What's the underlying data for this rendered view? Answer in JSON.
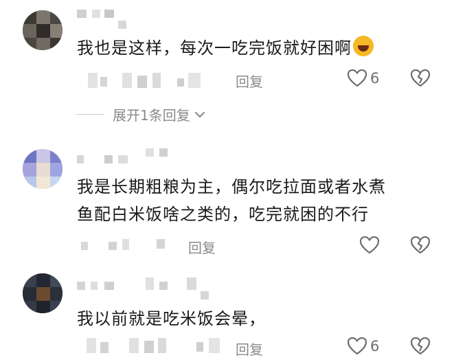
{
  "comments": [
    {
      "text_lines": [
        "我也是这样，每次一吃完饭就好困啊"
      ],
      "emoji": "laughing-crying-emoji",
      "reply_label": "回复",
      "likes": "6",
      "expand_label": "展开1条回复"
    },
    {
      "text_lines": [
        "我是长期粗粮为主，偶尔吃拉面或者水煮",
        "鱼配白米饭啥之类的，吃完就困的不行"
      ],
      "reply_label": "回复",
      "likes": ""
    },
    {
      "text_lines": [
        "我以前就是吃米饭会晕，"
      ],
      "reply_label": "回复",
      "likes": "6"
    }
  ],
  "icons": {
    "like": "heart-outline-icon",
    "dislike": "broken-heart-icon",
    "expand": "chevron-down-icon"
  },
  "colors": {
    "text": "#1a1a1a",
    "secondary": "#8a8a8a",
    "icon": "#6e6e6e"
  }
}
